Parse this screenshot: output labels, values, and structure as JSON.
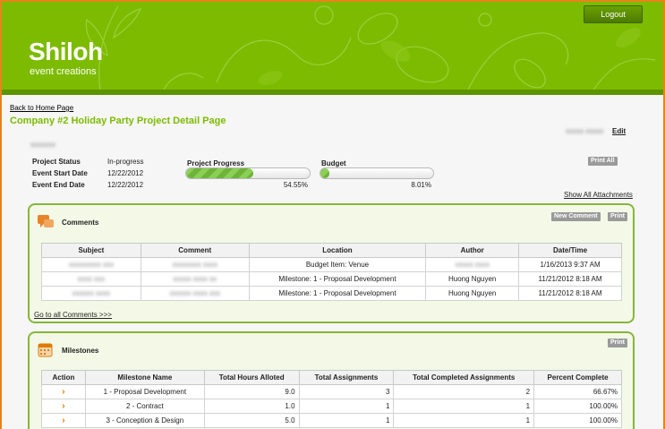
{
  "header": {
    "logo_main": "Shiloh",
    "logo_sub": "event creations",
    "logout_label": "Logout"
  },
  "nav": {
    "back_label": "Back to Home Page"
  },
  "page": {
    "title": "Company #2 Holiday Party Project Detail Page",
    "edit_label": "Edit"
  },
  "info": {
    "status_label": "Project Status",
    "status_value": "In-progress",
    "start_label": "Event Start Date",
    "start_value": "12/22/2012",
    "end_label": "Event End Date",
    "end_value": "12/22/2012"
  },
  "progress": {
    "project_label": "Project Progress",
    "project_pct_text": "54.55%",
    "project_fraction": 0.5455,
    "budget_label": "Budget",
    "budget_pct_text": "8.01%",
    "budget_fraction": 0.0801
  },
  "actions": {
    "print_all": "Print All",
    "show_attachments": "Show All Attachments"
  },
  "comments": {
    "title": "Comments",
    "new_comment": "New Comment",
    "print": "Print",
    "columns": [
      "Subject",
      "Comment",
      "Location",
      "Author",
      "Date/Time"
    ],
    "rows": [
      {
        "location": "Budget Item: Venue",
        "author": "",
        "datetime": "1/16/2013 9:37 AM"
      },
      {
        "location": "Milestone: 1 - Proposal Development",
        "author": "Huong Nguyen",
        "datetime": "11/21/2012 8:18 AM"
      },
      {
        "location": "Milestone: 1 - Proposal Development",
        "author": "Huong Nguyen",
        "datetime": "11/21/2012 8:18 AM"
      }
    ],
    "goto_label": "Go to all Comments >>>"
  },
  "milestones": {
    "title": "Milestones",
    "print": "Print",
    "columns": [
      "Action",
      "Milestone Name",
      "Total Hours Alloted",
      "Total Assignments",
      "Total Completed Assignments",
      "Percent Complete"
    ],
    "rows": [
      {
        "name": "1 - Proposal Development",
        "hours": "9.0",
        "assignments": "3",
        "completed": "2",
        "percent": "66.67%"
      },
      {
        "name": "2 - Contract",
        "hours": "1.0",
        "assignments": "1",
        "completed": "1",
        "percent": "100.00%"
      },
      {
        "name": "3 - Conception & Design",
        "hours": "5.0",
        "assignments": "1",
        "completed": "1",
        "percent": "100.00%"
      }
    ]
  },
  "colors": {
    "brand_green": "#7cbb00",
    "panel_border": "#86b63c",
    "accent_orange": "#e07a00"
  }
}
